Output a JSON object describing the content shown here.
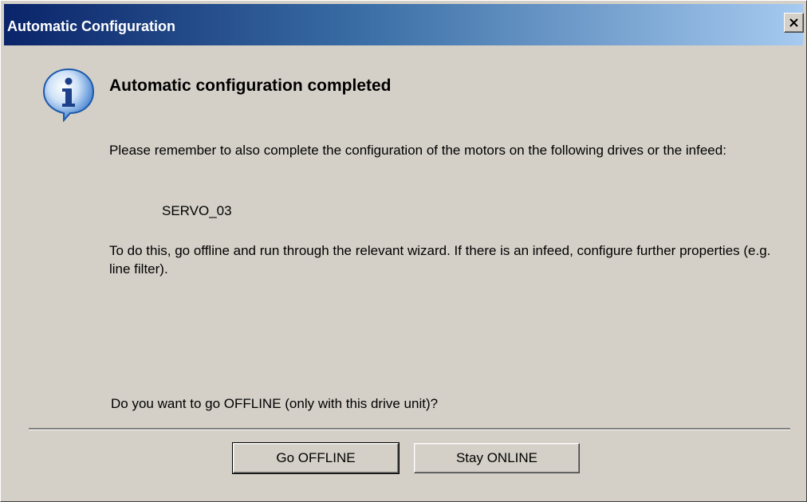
{
  "window": {
    "title": "Automatic Configuration",
    "close_glyph": "close-icon"
  },
  "message": {
    "icon": "info-icon",
    "heading": "Automatic configuration completed",
    "paragraph1": "Please remember to also complete the configuration of the motors on the following drives or the infeed:",
    "drive": "SERVO_03",
    "paragraph2": "To do this, go offline and run through the relevant wizard. If there is an infeed, configure further properties (e.g. line filter).",
    "question": "Do you want to go OFFLINE (only with this drive unit)?"
  },
  "buttons": {
    "go_offline": "Go OFFLINE",
    "stay_online": "Stay ONLINE"
  },
  "colors": {
    "dialog_bg": "#d4d0c8",
    "titlebar_start": "#0a246a",
    "titlebar_end": "#a6caf0",
    "info_icon": "#1e5aa8"
  }
}
